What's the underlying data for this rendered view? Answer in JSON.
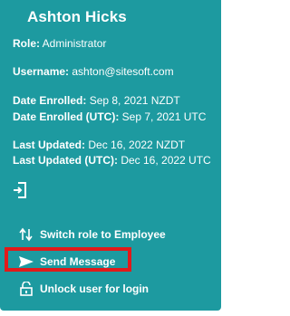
{
  "user": {
    "name": "Ashton Hicks"
  },
  "details": {
    "role_label": "Role:",
    "role_value": " Administrator",
    "username_label": "Username:",
    "username_value": " ashton@sitesoft.com",
    "date_enrolled_label": "Date Enrolled:",
    "date_enrolled_value": " Sep 8, 2021 NZDT",
    "date_enrolled_utc_label": "Date Enrolled (UTC):",
    "date_enrolled_utc_value": " Sep 7, 2021 UTC",
    "last_updated_label": "Last Updated:",
    "last_updated_value": " Dec 16, 2022 NZDT",
    "last_updated_utc_label": "Last Updated (UTC):",
    "last_updated_utc_value": " Dec 16, 2022 UTC"
  },
  "actions": {
    "switch_role": "Switch role to Employee",
    "send_message": "Send Message",
    "unlock_user": "Unlock user for login"
  },
  "icons": {
    "exit": "exit-icon",
    "switch_role": "swap-vertical-icon",
    "send_message": "send-icon",
    "unlock_user": "unlock-icon"
  },
  "colors": {
    "card_background": "#1d9aa0",
    "text": "#ffffff",
    "highlight_border": "#e11a1a"
  }
}
